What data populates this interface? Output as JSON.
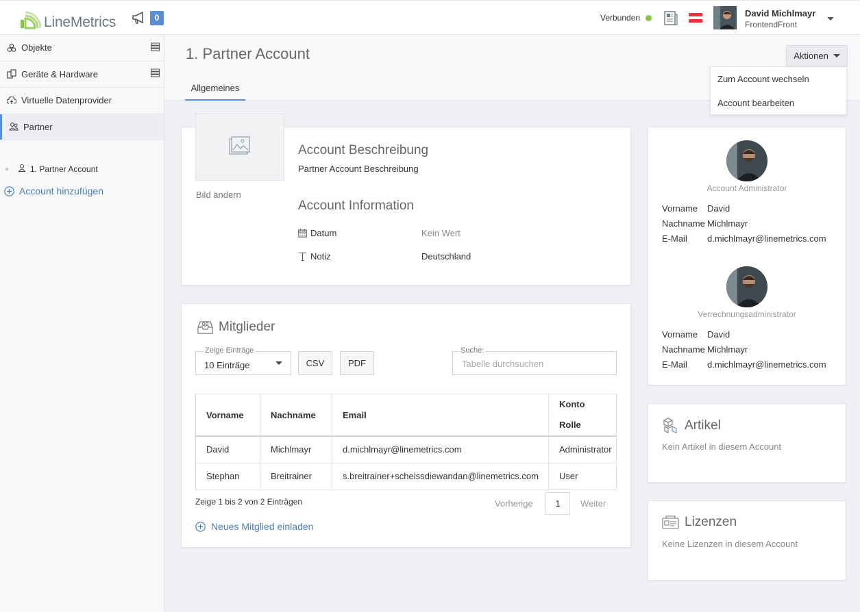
{
  "brand": {
    "name": "LineMetrics"
  },
  "header": {
    "notification_count": "0",
    "connection_status": "Verbunden",
    "user": {
      "name": "David Michlmayr",
      "org": "FrontendFront"
    }
  },
  "sidebar": {
    "items": [
      {
        "label": "Objekte",
        "icon": "objects-icon"
      },
      {
        "label": "Geräte & Hardware",
        "icon": "devices-icon"
      },
      {
        "label": "Virtuelle Datenprovider",
        "icon": "cloud-upload-icon"
      },
      {
        "label": "Partner",
        "icon": "partner-icon"
      }
    ],
    "sub_item": "1. Partner Account",
    "add_account": "Account hinzufügen"
  },
  "page": {
    "title": "1. Partner Account",
    "tab": "Allgemeines",
    "actions_label": "Aktionen",
    "actions_menu": [
      "Zum Account wechseln",
      "Account bearbeiten"
    ]
  },
  "account": {
    "change_image": "Bild ändern",
    "description_heading": "Account Beschreibung",
    "description_text": "Partner Account Beschreibung",
    "info_heading": "Account Information",
    "date_label": "Datum",
    "date_value": "Kein Wert",
    "note_label": "Notiz",
    "note_value": "Deutschland"
  },
  "members": {
    "heading": "Mitglieder",
    "entries_label": "Zeige Einträge",
    "entries_value": "10 Einträge",
    "csv_label": "CSV",
    "pdf_label": "PDF",
    "search_label": "Suche:",
    "search_placeholder": "Tabelle durchsuchen",
    "columns": [
      "Vorname",
      "Nachname",
      "Email",
      "Konto",
      "Rolle"
    ],
    "rows": [
      {
        "first": "David",
        "last": "Michlmayr",
        "email": "d.michlmayr@linemetrics.com",
        "role": "Administrator"
      },
      {
        "first": "Stephan",
        "last": "Breitrainer",
        "email": "s.breitrainer+scheissdiewandan@linemetrics.com",
        "role": "User"
      }
    ],
    "info": "Zeige 1 bis 2 von 2 Einträgen",
    "prev_label": "Vorherige",
    "page_number": "1",
    "next_label": "Weiter",
    "invite_label": "Neues Mitglied einladen"
  },
  "admins": [
    {
      "role": "Account Administrator",
      "first_label": "Vorname",
      "first": "David",
      "last_label": "Nachname",
      "last": "Michlmayr",
      "email_label": "E-Mail",
      "email": "d.michlmayr@linemetrics.com"
    },
    {
      "role": "Verrechnungsadministrator",
      "first_label": "Vorname",
      "first": "David",
      "last_label": "Nachname",
      "last": "Michlmayr",
      "email_label": "E-Mail",
      "email": "d.michlmayr@linemetrics.com"
    }
  ],
  "articles": {
    "heading": "Artikel",
    "empty": "Kein Artikel in diesem Account"
  },
  "licenses": {
    "heading": "Lizenzen",
    "empty": "Keine Lizenzen in diesem Account"
  },
  "colors": {
    "accent": "#5b8fd4",
    "link": "#4a7cb8",
    "status": "#8bc34a",
    "status_bar": "#f2b04a"
  }
}
